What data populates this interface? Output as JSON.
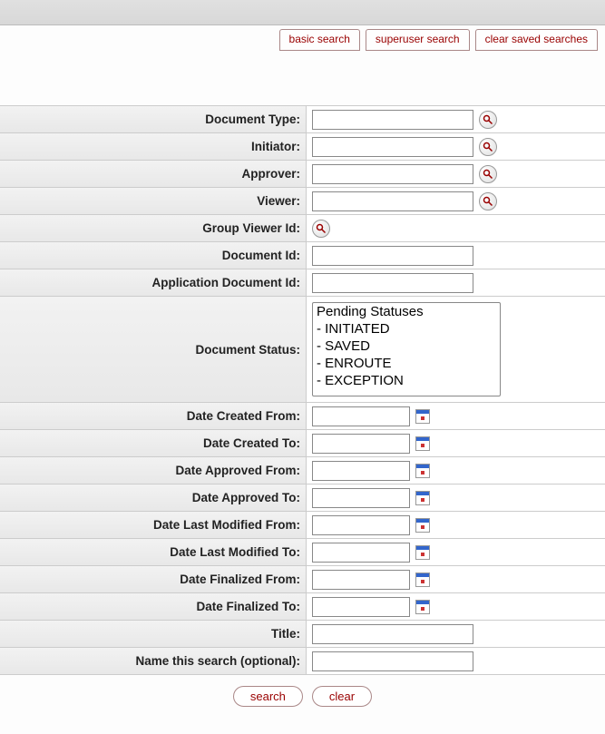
{
  "tabs": {
    "basic": "basic search",
    "superuser": "superuser search",
    "clear_saved": "clear saved searches"
  },
  "labels": {
    "document_type": "Document Type:",
    "initiator": "Initiator:",
    "approver": "Approver:",
    "viewer": "Viewer:",
    "group_viewer_id": "Group Viewer Id:",
    "document_id": "Document Id:",
    "application_document_id": "Application Document Id:",
    "document_status": "Document Status:",
    "date_created_from": "Date Created From:",
    "date_created_to": "Date Created To:",
    "date_approved_from": "Date Approved From:",
    "date_approved_to": "Date Approved To:",
    "date_last_modified_from": "Date Last Modified From:",
    "date_last_modified_to": "Date Last Modified To:",
    "date_finalized_from": "Date Finalized From:",
    "date_finalized_to": "Date Finalized To:",
    "title": "Title:",
    "name_this_search": "Name this search (optional):"
  },
  "status_options": [
    "Pending Statuses",
    "- INITIATED",
    "- SAVED",
    "- ENROUTE",
    "- EXCEPTION"
  ],
  "buttons": {
    "search": "search",
    "clear": "clear"
  },
  "values": {
    "document_type": "",
    "initiator": "",
    "approver": "",
    "viewer": "",
    "document_id": "",
    "application_document_id": "",
    "date_created_from": "",
    "date_created_to": "",
    "date_approved_from": "",
    "date_approved_to": "",
    "date_last_modified_from": "",
    "date_last_modified_to": "",
    "date_finalized_from": "",
    "date_finalized_to": "",
    "title": "",
    "name_this_search": ""
  }
}
